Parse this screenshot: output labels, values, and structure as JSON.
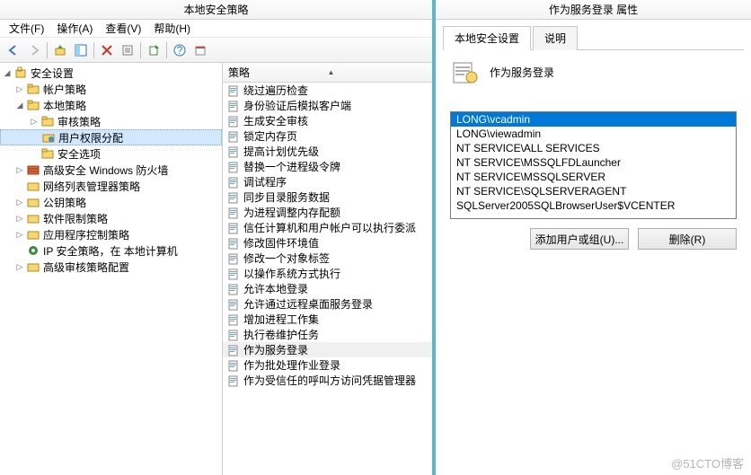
{
  "window": {
    "title": "本地安全策略"
  },
  "menu": {
    "file": "文件(F)",
    "action": "操作(A)",
    "view": "查看(V)",
    "help": "帮助(H)"
  },
  "tree": {
    "root": "安全设置",
    "n1": "帐户策略",
    "n2": "本地策略",
    "n2a": "审核策略",
    "n2b": "用户权限分配",
    "n2c": "安全选项",
    "n3": "高级安全 Windows 防火墙",
    "n4": "网络列表管理器策略",
    "n5": "公钥策略",
    "n6": "软件限制策略",
    "n7": "应用程序控制策略",
    "n8": "IP 安全策略，在 本地计算机",
    "n9": "高级审核策略配置"
  },
  "list": {
    "header": "策略",
    "items": [
      "绕过遍历检查",
      "身份验证后模拟客户端",
      "生成安全审核",
      "锁定内存页",
      "提高计划优先级",
      "替换一个进程级令牌",
      "调试程序",
      "同步目录服务数据",
      "为进程调整内存配额",
      "信任计算机和用户帐户可以执行委派",
      "修改固件环境值",
      "修改一个对象标签",
      "以操作系统方式执行",
      "允许本地登录",
      "允许通过远程桌面服务登录",
      "增加进程工作集",
      "执行卷维护任务",
      "作为服务登录",
      "作为批处理作业登录",
      "作为受信任的呼叫方访问凭据管理器"
    ],
    "selected_index": 17
  },
  "props": {
    "title": "作为服务登录 属性",
    "tab1": "本地安全设置",
    "tab2": "说明",
    "heading": "作为服务登录",
    "users": [
      "LONG\\vcadmin",
      "LONG\\viewadmin",
      "NT SERVICE\\ALL SERVICES",
      "NT SERVICE\\MSSQLFDLauncher",
      "NT SERVICE\\MSSQLSERVER",
      "NT SERVICE\\SQLSERVERAGENT",
      "SQLServer2005SQLBrowserUser$VCENTER"
    ],
    "selected_user": 0,
    "add_btn": "添加用户或组(U)...",
    "del_btn": "删除(R)"
  },
  "watermark": "@51CTO博客"
}
